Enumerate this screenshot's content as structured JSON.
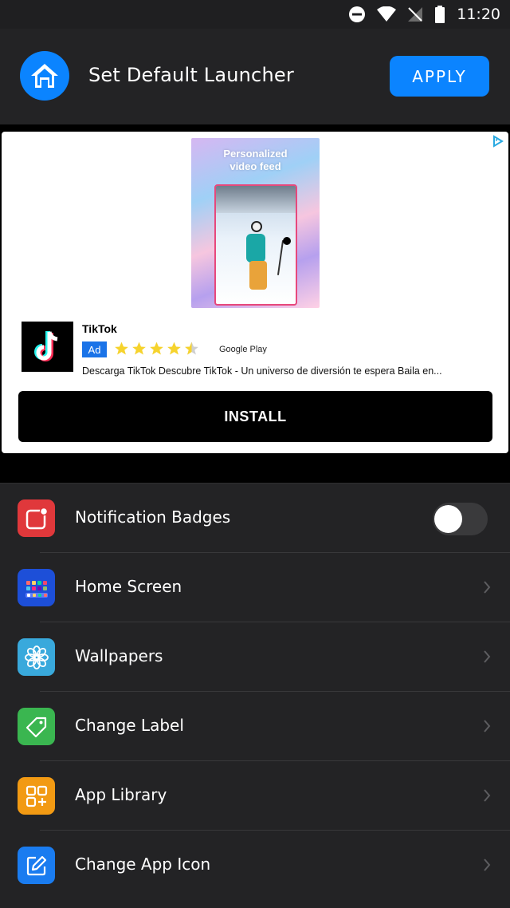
{
  "status_bar": {
    "time": "11:20",
    "icons": [
      "do-not-disturb-icon",
      "wifi-icon",
      "no-signal-icon",
      "battery-icon"
    ]
  },
  "header": {
    "title": "Set Default Launcher",
    "apply_label": "APPLY",
    "icon": "home-icon",
    "accent_color": "#0b84ff"
  },
  "ad": {
    "image_headline_line1": "Personalized",
    "image_headline_line2": "video feed",
    "app_name": "TikTok",
    "badge": "Ad",
    "rating": 4.5,
    "store": "Google Play",
    "description": "Descarga TikTok Descubre TikTok - Un universo de diversión te espera Baila en...",
    "install_label": "INSTALL",
    "adchoices_icon": "adchoices-icon"
  },
  "settings": {
    "items": [
      {
        "label": "Notification Badges",
        "icon": "notification-badge-icon",
        "color": "#e0383b",
        "control": "toggle",
        "toggle_on": false
      },
      {
        "label": "Home Screen",
        "icon": "home-screen-grid-icon",
        "color": "#1d4fd8",
        "control": "chevron"
      },
      {
        "label": "Wallpapers",
        "icon": "flower-icon",
        "color": "#39a9dc",
        "control": "chevron"
      },
      {
        "label": "Change Label",
        "icon": "tag-icon",
        "color": "#3ab650",
        "control": "chevron"
      },
      {
        "label": "App Library",
        "icon": "app-library-icon",
        "color": "#f29a13",
        "control": "chevron"
      },
      {
        "label": "Change App Icon",
        "icon": "edit-icon",
        "color": "#1a7cf0",
        "control": "chevron"
      }
    ]
  }
}
